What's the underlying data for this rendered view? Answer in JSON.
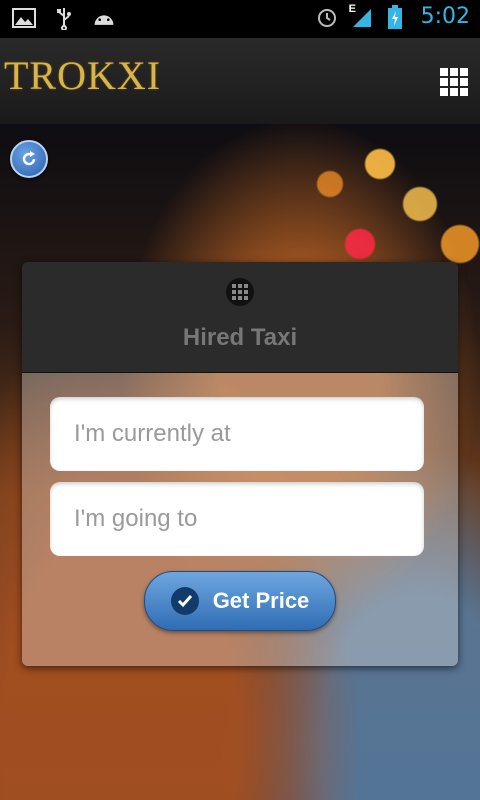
{
  "status_bar": {
    "time": "5:02",
    "network_label": "E",
    "icons": [
      "image-icon",
      "usb-icon",
      "android-icon",
      "alarm-icon",
      "signal-icon",
      "battery-charging-icon"
    ]
  },
  "header": {
    "logo_text": "TROKXI",
    "menu_icon": "grid-menu-icon"
  },
  "refresh_icon": "refresh-icon",
  "card": {
    "title": "Hired Taxi",
    "from_placeholder": "I'm currently at",
    "to_placeholder": "I'm going to",
    "from_value": "",
    "to_value": "",
    "button_label": "Get Price"
  },
  "colors": {
    "accent": "#33b5e5",
    "button": "#2f6db3",
    "logo": "#d9b44a"
  }
}
